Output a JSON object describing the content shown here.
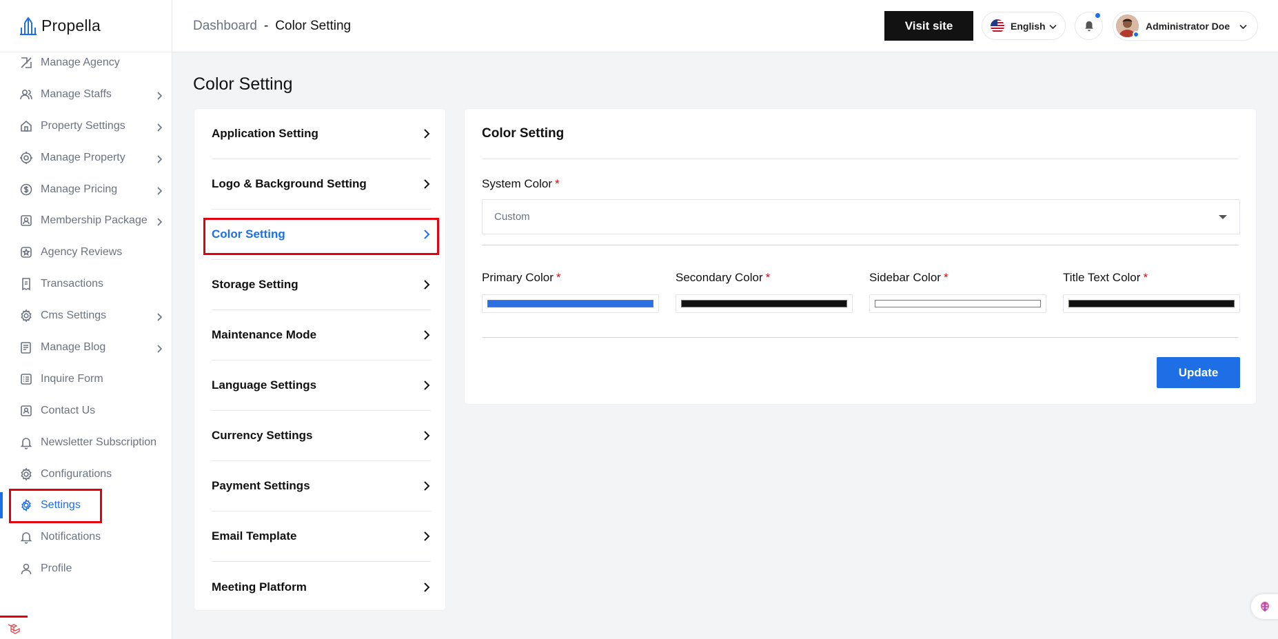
{
  "brand": {
    "name": "Propella"
  },
  "sidebar": {
    "items": [
      {
        "label": "Manage Agency",
        "icon": "agency-icon",
        "has_submenu": false
      },
      {
        "label": "Manage Staffs",
        "icon": "users-icon",
        "has_submenu": true
      },
      {
        "label": "Property Settings",
        "icon": "home-icon",
        "has_submenu": true
      },
      {
        "label": "Manage Property",
        "icon": "building-icon",
        "has_submenu": true
      },
      {
        "label": "Manage Pricing",
        "icon": "dollar-icon",
        "has_submenu": true
      },
      {
        "label": "Membership Package",
        "icon": "membership-icon",
        "has_submenu": true
      },
      {
        "label": "Agency Reviews",
        "icon": "star-icon",
        "has_submenu": false
      },
      {
        "label": "Transactions",
        "icon": "receipt-icon",
        "has_submenu": false
      },
      {
        "label": "Cms Settings",
        "icon": "cms-gear-icon",
        "has_submenu": true
      },
      {
        "label": "Manage Blog",
        "icon": "blog-icon",
        "has_submenu": true
      },
      {
        "label": "Inquire Form",
        "icon": "form-icon",
        "has_submenu": false
      },
      {
        "label": "Contact Us",
        "icon": "contact-icon",
        "has_submenu": false
      },
      {
        "label": "Newsletter Subscription",
        "icon": "bell-icon",
        "has_submenu": false
      },
      {
        "label": "Configurations",
        "icon": "config-gear-icon",
        "has_submenu": false
      },
      {
        "label": "Settings",
        "icon": "gear-icon",
        "has_submenu": false,
        "active": true
      },
      {
        "label": "Notifications",
        "icon": "bell-icon",
        "has_submenu": false
      },
      {
        "label": "Profile",
        "icon": "user-icon",
        "has_submenu": false
      }
    ]
  },
  "header": {
    "breadcrumb": {
      "parent": "Dashboard",
      "separator": "-",
      "current": "Color Setting"
    },
    "visit_site_label": "Visit site",
    "language": "English",
    "user_name": "Administrator Doe"
  },
  "main": {
    "page_title": "Color Setting",
    "settings_menu": [
      {
        "label": "Application Setting"
      },
      {
        "label": "Logo & Background Setting"
      },
      {
        "label": "Color Setting",
        "active": true
      },
      {
        "label": "Storage Setting"
      },
      {
        "label": "Maintenance Mode"
      },
      {
        "label": "Language Settings"
      },
      {
        "label": "Currency Settings"
      },
      {
        "label": "Payment Settings"
      },
      {
        "label": "Email Template"
      },
      {
        "label": "Meeting Platform"
      }
    ],
    "form": {
      "title": "Color Setting",
      "system_color_label": "System Color",
      "system_color_value": "Custom",
      "required_mark": "*",
      "colors": [
        {
          "label": "Primary Color",
          "value": "#2b6fe0"
        },
        {
          "label": "Secondary Color",
          "value": "#111111"
        },
        {
          "label": "Sidebar Color",
          "value": "#ffffff"
        },
        {
          "label": "Title Text Color",
          "value": "#111111"
        }
      ],
      "update_label": "Update"
    }
  },
  "colors": {
    "accent": "#1e6fe6",
    "highlight_box": "#e3000f",
    "dark_button": "#121212"
  }
}
